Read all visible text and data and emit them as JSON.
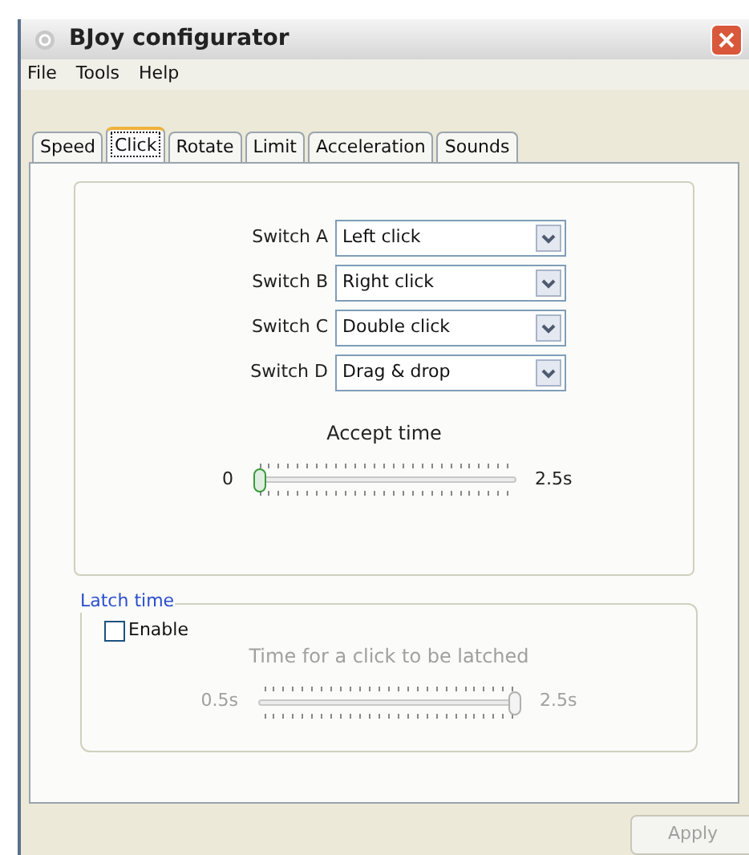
{
  "window": {
    "title": "BJoy configurator"
  },
  "menu": [
    "File",
    "Tools",
    "Help"
  ],
  "tabs": [
    {
      "label": "Speed",
      "selected": false
    },
    {
      "label": "Click",
      "selected": true
    },
    {
      "label": "Rotate",
      "selected": false
    },
    {
      "label": "Limit",
      "selected": false
    },
    {
      "label": "Acceleration",
      "selected": false
    },
    {
      "label": "Sounds",
      "selected": false
    }
  ],
  "switches": [
    {
      "label": "Switch A",
      "value": "Left click"
    },
    {
      "label": "Switch B",
      "value": "Right click"
    },
    {
      "label": "Switch C",
      "value": "Double click"
    },
    {
      "label": "Switch D",
      "value": "Drag & drop"
    }
  ],
  "accept_time": {
    "title": "Accept time",
    "min": "0",
    "max": "2.5s",
    "level": 0,
    "disabled": false
  },
  "latch": {
    "title": "Latch time",
    "enable_label": "Enable",
    "checked": false,
    "slider": {
      "title": "Time for a click to be latched",
      "min": "0.5s",
      "max": "2.5s",
      "level": 1,
      "disabled": true
    }
  },
  "apply": {
    "label": "Apply",
    "disabled": true
  }
}
